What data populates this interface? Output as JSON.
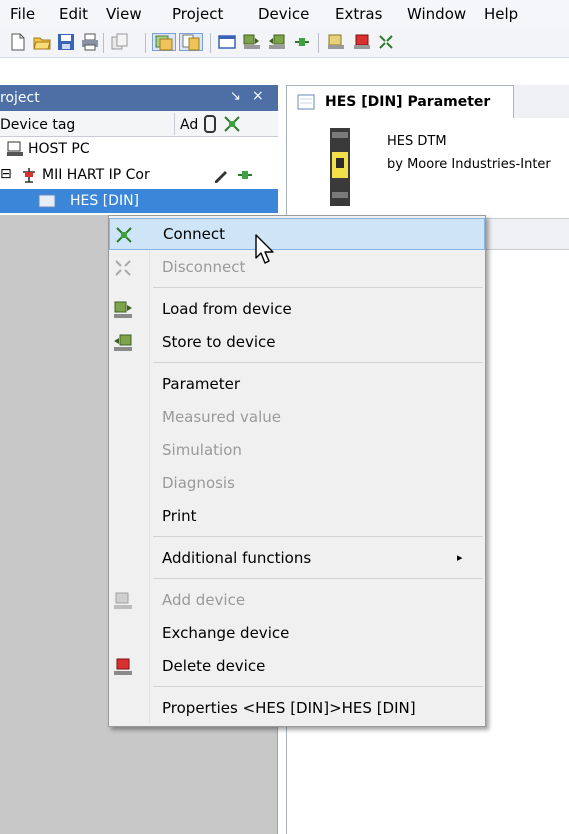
{
  "menubar": {
    "items": [
      "File",
      "Edit",
      "View",
      "Project",
      "Device",
      "Extras",
      "Window",
      "Help"
    ]
  },
  "toolbar": {
    "icons": [
      "new-icon",
      "open-icon",
      "save-icon",
      "print-icon",
      "copy-icon",
      "project-view-icon",
      "device-catalog-icon",
      "window-icon",
      "load-from-device-icon",
      "store-to-device-icon",
      "connect-icon",
      "offline-icon",
      "delete-icon",
      "connect-icon"
    ]
  },
  "project_panel": {
    "title": "roject",
    "pin": "↘",
    "close": "×",
    "column_device_tag": "Device tag",
    "column_address": "Ad ",
    "rows": [
      {
        "label": "HOST PC",
        "icon": "host-pc-icon"
      },
      {
        "label": "MII HART IP Cor",
        "icon": "hart-ip-icon",
        "expander": "⊟"
      },
      {
        "label": "HES [DIN]",
        "icon": "device-icon"
      }
    ]
  },
  "document_tab": {
    "title": "HES [DIN] Parameter"
  },
  "dtm_info": {
    "name": "HES DTM",
    "vendor": "by Moore Industries-Inter"
  },
  "context_menu": {
    "items": [
      {
        "label": "Connect",
        "enabled": true,
        "highlighted": true,
        "icon": "connect-icon"
      },
      {
        "label": "Disconnect",
        "enabled": false,
        "icon": "disconnect-icon"
      },
      {
        "label": "Load from device",
        "enabled": true,
        "icon": "load-from-device-icon"
      },
      {
        "label": "Store to device",
        "enabled": true,
        "icon": "store-to-device-icon"
      },
      {
        "label": "Parameter",
        "enabled": true
      },
      {
        "label": "Measured value",
        "enabled": false
      },
      {
        "label": "Simulation",
        "enabled": false
      },
      {
        "label": "Diagnosis",
        "enabled": false
      },
      {
        "label": "Print",
        "enabled": true
      },
      {
        "label": "Additional functions",
        "enabled": true,
        "submenu": true,
        "arrow": "▸"
      },
      {
        "label": "Add device",
        "enabled": false,
        "icon": "add-device-icon"
      },
      {
        "label": "Exchange device",
        "enabled": true
      },
      {
        "label": "Delete device",
        "enabled": true,
        "icon": "delete-device-icon"
      },
      {
        "label": "Properties <HES [DIN]>HES [DIN]",
        "enabled": true
      }
    ]
  },
  "colors": {
    "panel_title": "#4d6fa6",
    "selection": "#3b86d9",
    "menu_highlight": "#cde5f7",
    "menu_disabled_text": "#9a9a9a"
  }
}
